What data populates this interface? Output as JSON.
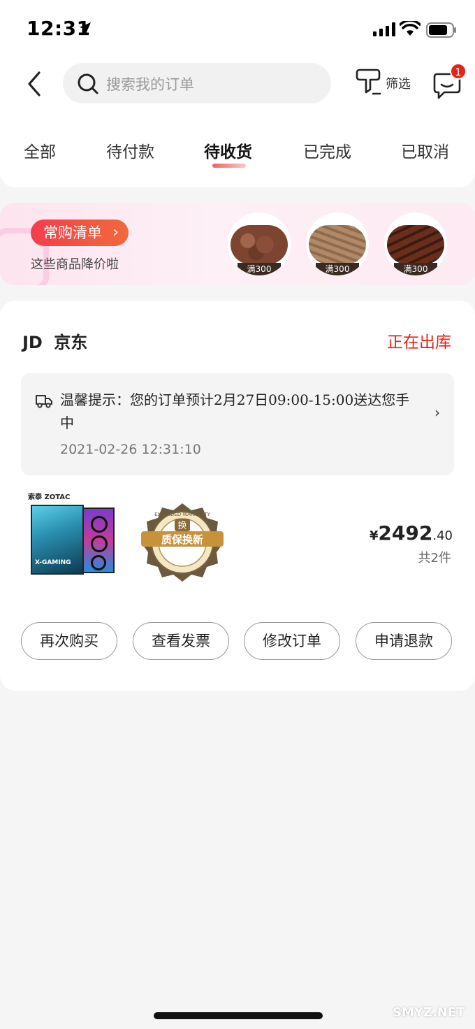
{
  "status_bar": {
    "time": "12:31"
  },
  "nav": {
    "search_placeholder": "搜索我的订单",
    "filter_label": "筛选",
    "message_badge": "1"
  },
  "tabs": [
    {
      "label": "全部"
    },
    {
      "label": "待付款"
    },
    {
      "label": "待收货",
      "active": true
    },
    {
      "label": "已完成"
    },
    {
      "label": "已取消"
    }
  ],
  "promo": {
    "title": "常购清单",
    "subtitle": "这些商品降价啦",
    "thumb_tag": "满300"
  },
  "order": {
    "shop_logo": "JD",
    "shop_name": "京东",
    "status": "正在出库",
    "tip_text": "温馨提示：您的订单预计2月27日09:00-15:00送达您手中",
    "tip_time": "2021-02-26 12:31:10",
    "product1_brand": "索泰 ZOTAC",
    "product1_label": "X-GAMING",
    "product2_badge": "换",
    "product2_text": "质保换新",
    "product2_arc": "EXTENDED WARRANTY",
    "price_currency": "¥",
    "price_int": "2492",
    "price_dec": ".40",
    "quantity": "共2件"
  },
  "actions": [
    {
      "label": "再次购买"
    },
    {
      "label": "查看发票"
    },
    {
      "label": "修改订单"
    },
    {
      "label": "申请退款"
    }
  ],
  "watermark": "SMYZ.NET",
  "colors": {
    "accent": "#e1251b"
  }
}
